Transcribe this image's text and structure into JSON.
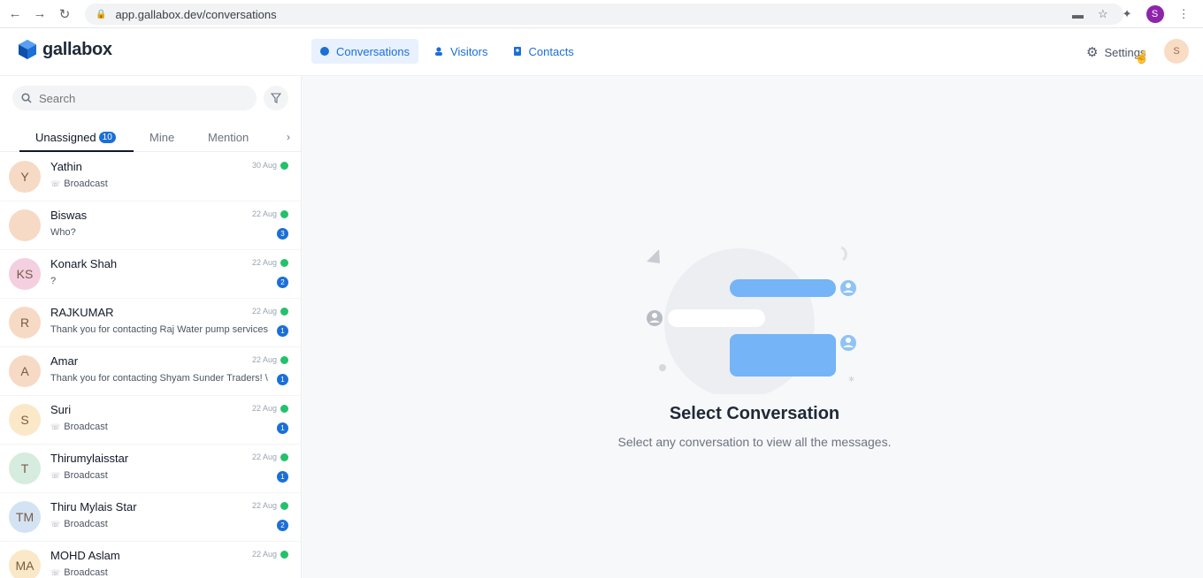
{
  "browser": {
    "url": "app.gallabox.dev/conversations",
    "profile_initial": "S"
  },
  "header": {
    "brand": "gallabox",
    "tabs": [
      {
        "label": "Conversations",
        "active": true
      },
      {
        "label": "Visitors",
        "active": false
      },
      {
        "label": "Contacts",
        "active": false
      }
    ],
    "settings_label": "Settings",
    "user_initial": "S"
  },
  "sidebar": {
    "search_placeholder": "Search",
    "tabs": [
      {
        "label": "Unassigned",
        "badge": "10",
        "active": true
      },
      {
        "label": "Mine",
        "active": false
      },
      {
        "label": "Mention",
        "active": false
      }
    ],
    "conversations": [
      {
        "initials": "Y",
        "name": "Yathin",
        "date": "30 Aug",
        "preview": "Broadcast",
        "broadcast": true,
        "unread": "",
        "avatar_color": "#f6dac5"
      },
      {
        "initials": "",
        "name": "Biswas",
        "date": "22 Aug",
        "preview": "Who?",
        "broadcast": false,
        "unread": "3",
        "avatar_color": "#f6dac5"
      },
      {
        "initials": "KS",
        "name": "Konark Shah",
        "date": "22 Aug",
        "preview": "?",
        "broadcast": false,
        "unread": "2",
        "avatar_color": "#f3cfe0"
      },
      {
        "initials": "R",
        "name": "RAJKUMAR",
        "date": "22 Aug",
        "preview": "Thank you for contacting Raj Water pump services",
        "broadcast": false,
        "unread": "1",
        "avatar_color": "#f6dac5"
      },
      {
        "initials": "A",
        "name": "Amar",
        "date": "22 Aug",
        "preview": "Thank you for contacting Shyam Sunder Traders! \\",
        "broadcast": false,
        "unread": "1",
        "avatar_color": "#f6dac5"
      },
      {
        "initials": "S",
        "name": "Suri",
        "date": "22 Aug",
        "preview": "Broadcast",
        "broadcast": true,
        "unread": "1",
        "avatar_color": "#fbe8c8"
      },
      {
        "initials": "T",
        "name": "Thirumylaisstar",
        "date": "22 Aug",
        "preview": "Broadcast",
        "broadcast": true,
        "unread": "1",
        "avatar_color": "#d5ecdf"
      },
      {
        "initials": "TM",
        "name": "Thiru Mylais Star",
        "date": "22 Aug",
        "preview": "Broadcast",
        "broadcast": true,
        "unread": "2",
        "avatar_color": "#d3e3f3"
      },
      {
        "initials": "MA",
        "name": "MOHD Aslam",
        "date": "22 Aug",
        "preview": "Broadcast",
        "broadcast": true,
        "unread": "",
        "avatar_color": "#fbe8c8"
      }
    ]
  },
  "main": {
    "empty_title": "Select Conversation",
    "empty_subtitle": "Select any conversation to view all the messages."
  },
  "colors": {
    "accent": "#1b6fd6",
    "whatsapp": "#25c06b",
    "bubble": "#74b4f7"
  }
}
